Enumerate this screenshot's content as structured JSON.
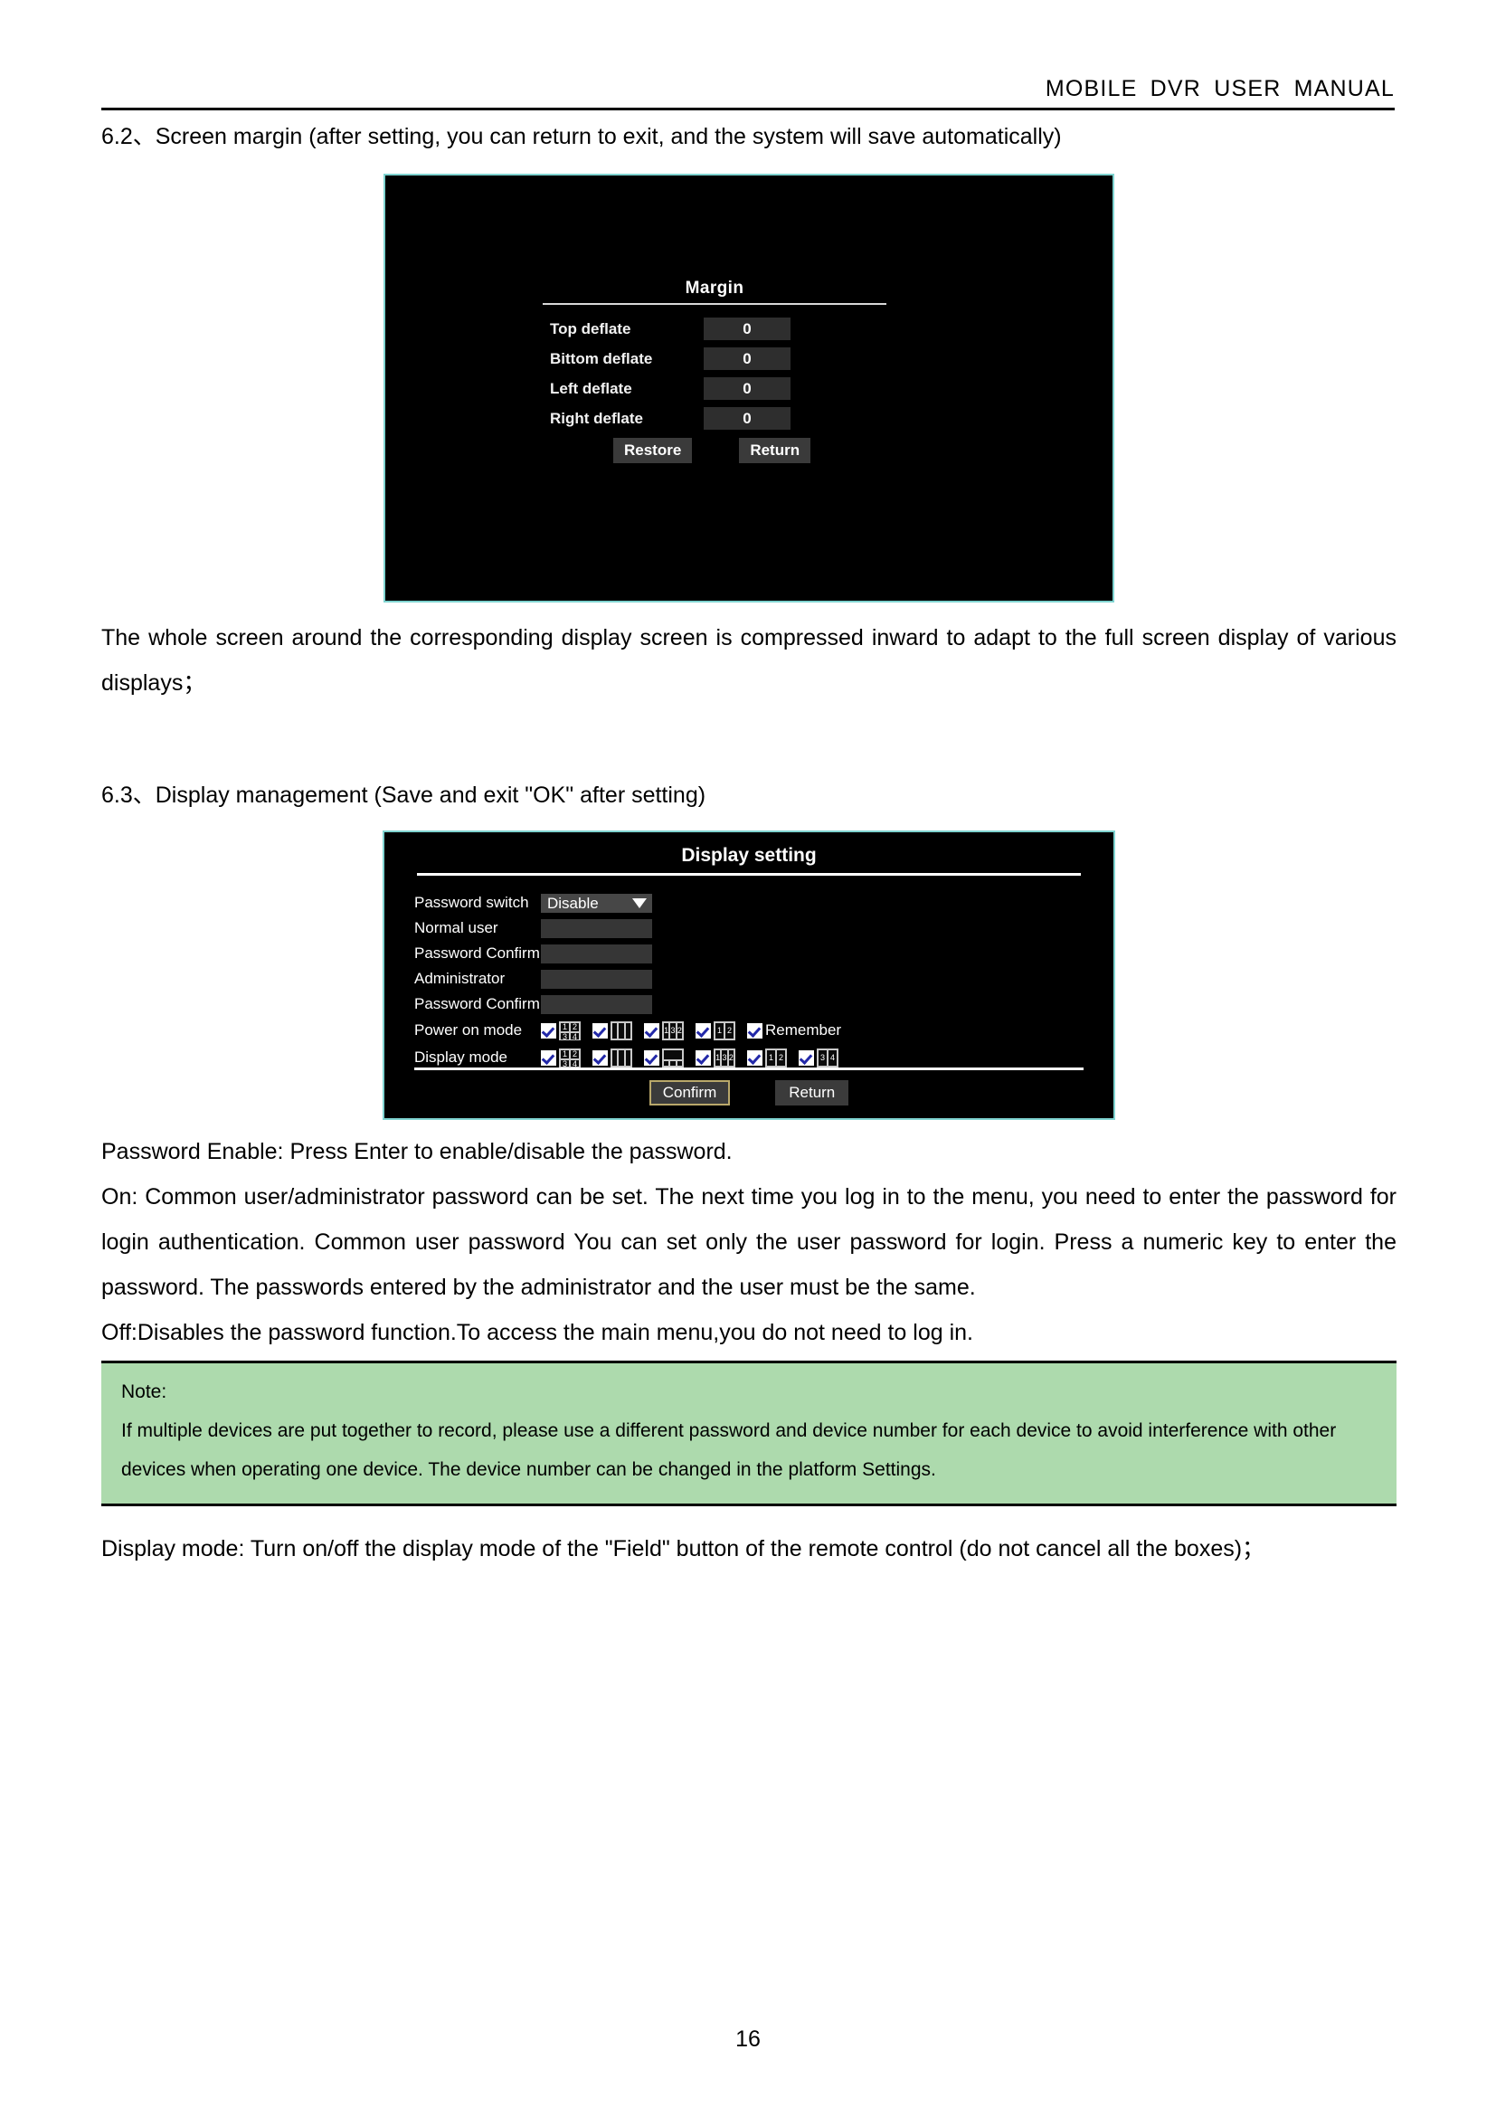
{
  "header": {
    "title": "MOBILE  DVR  USER  MANUAL"
  },
  "sections": {
    "s62_heading": "6.2、Screen margin (after setting, you can return to exit, and the system will save automatically)",
    "s62_para1": "The whole screen around the corresponding display screen is compressed inward to adapt to the full screen display of various displays；",
    "s63_heading": "6.3、Display management (Save and exit \"OK\" after setting)",
    "p_password_enable": "Password Enable: Press Enter to enable/disable the password.",
    "p_on": "On: Common user/administrator password can be set.    The next time you log in to the menu, you need to enter the password for login authentication.    Common user password You can set only the user password for login. Press a numeric key to enter the password. The passwords entered by the administrator and the user must be the same.",
    "p_off": "Off:Disables the password function.To access the main menu,you do not need to log in.",
    "p_display_mode": "Display mode: Turn on/off the display mode of the \"Field\" button of the remote control (do not cancel all the boxes)；"
  },
  "note": {
    "label": "Note:",
    "text": "If multiple devices are put together to record, please use a different password and device number for each device to avoid interference with other devices when operating one device. The device number can be changed in the platform Settings."
  },
  "margin_dialog": {
    "title": "Margin",
    "rows": [
      {
        "label": "Top deflate",
        "value": "0"
      },
      {
        "label": "Bittom deflate",
        "value": "0"
      },
      {
        "label": "Left deflate",
        "value": "0"
      },
      {
        "label": "Right deflate",
        "value": "0"
      }
    ],
    "restore_label": "Restore",
    "return_label": "Return"
  },
  "display_dialog": {
    "title": "Display setting",
    "fields": [
      {
        "label": "Password switch",
        "value": "Disable",
        "type": "select"
      },
      {
        "label": "Normal user",
        "value": "",
        "type": "text"
      },
      {
        "label": "Password Confirm",
        "value": "",
        "type": "text"
      },
      {
        "label": "Administrator",
        "value": "",
        "type": "text"
      },
      {
        "label": "Password Confirm",
        "value": "",
        "type": "text"
      }
    ],
    "power_on_mode": {
      "label": "Power on mode",
      "items": [
        {
          "icon": "layout-quad-1234",
          "checked": true,
          "text": ""
        },
        {
          "icon": "layout-3split-vertical",
          "checked": true,
          "text": ""
        },
        {
          "icon": "layout-3split-132",
          "checked": true,
          "text": ""
        },
        {
          "icon": "layout-2split-12",
          "checked": true,
          "text": ""
        },
        {
          "icon": "remember-checkbox",
          "checked": true,
          "text": "Remember"
        }
      ]
    },
    "display_mode": {
      "label": "Display mode",
      "items": [
        {
          "icon": "layout-quad-1234",
          "checked": true,
          "text": ""
        },
        {
          "icon": "layout-3split-vertical",
          "checked": true,
          "text": ""
        },
        {
          "icon": "layout-pip-large-top",
          "checked": true,
          "text": ""
        },
        {
          "icon": "layout-3split-132",
          "checked": true,
          "text": ""
        },
        {
          "icon": "layout-2split-12",
          "checked": true,
          "text": ""
        },
        {
          "icon": "layout-2split-34",
          "checked": true,
          "text": ""
        }
      ]
    },
    "confirm_label": "Confirm",
    "return_label": "Return",
    "quad_cells": [
      "1",
      "2",
      "3",
      "4"
    ],
    "cells_132": [
      "1",
      "3",
      "2"
    ],
    "cells_12": [
      "1",
      "2"
    ],
    "cells_34": [
      "3",
      "4"
    ],
    "colors": {
      "frame_border": "#7fd3d0",
      "background": "#000000",
      "field": "#363636",
      "confirm_border": "#b9a86a",
      "check_mark": "#2228a8"
    }
  },
  "footer": {
    "page_number": "16"
  }
}
